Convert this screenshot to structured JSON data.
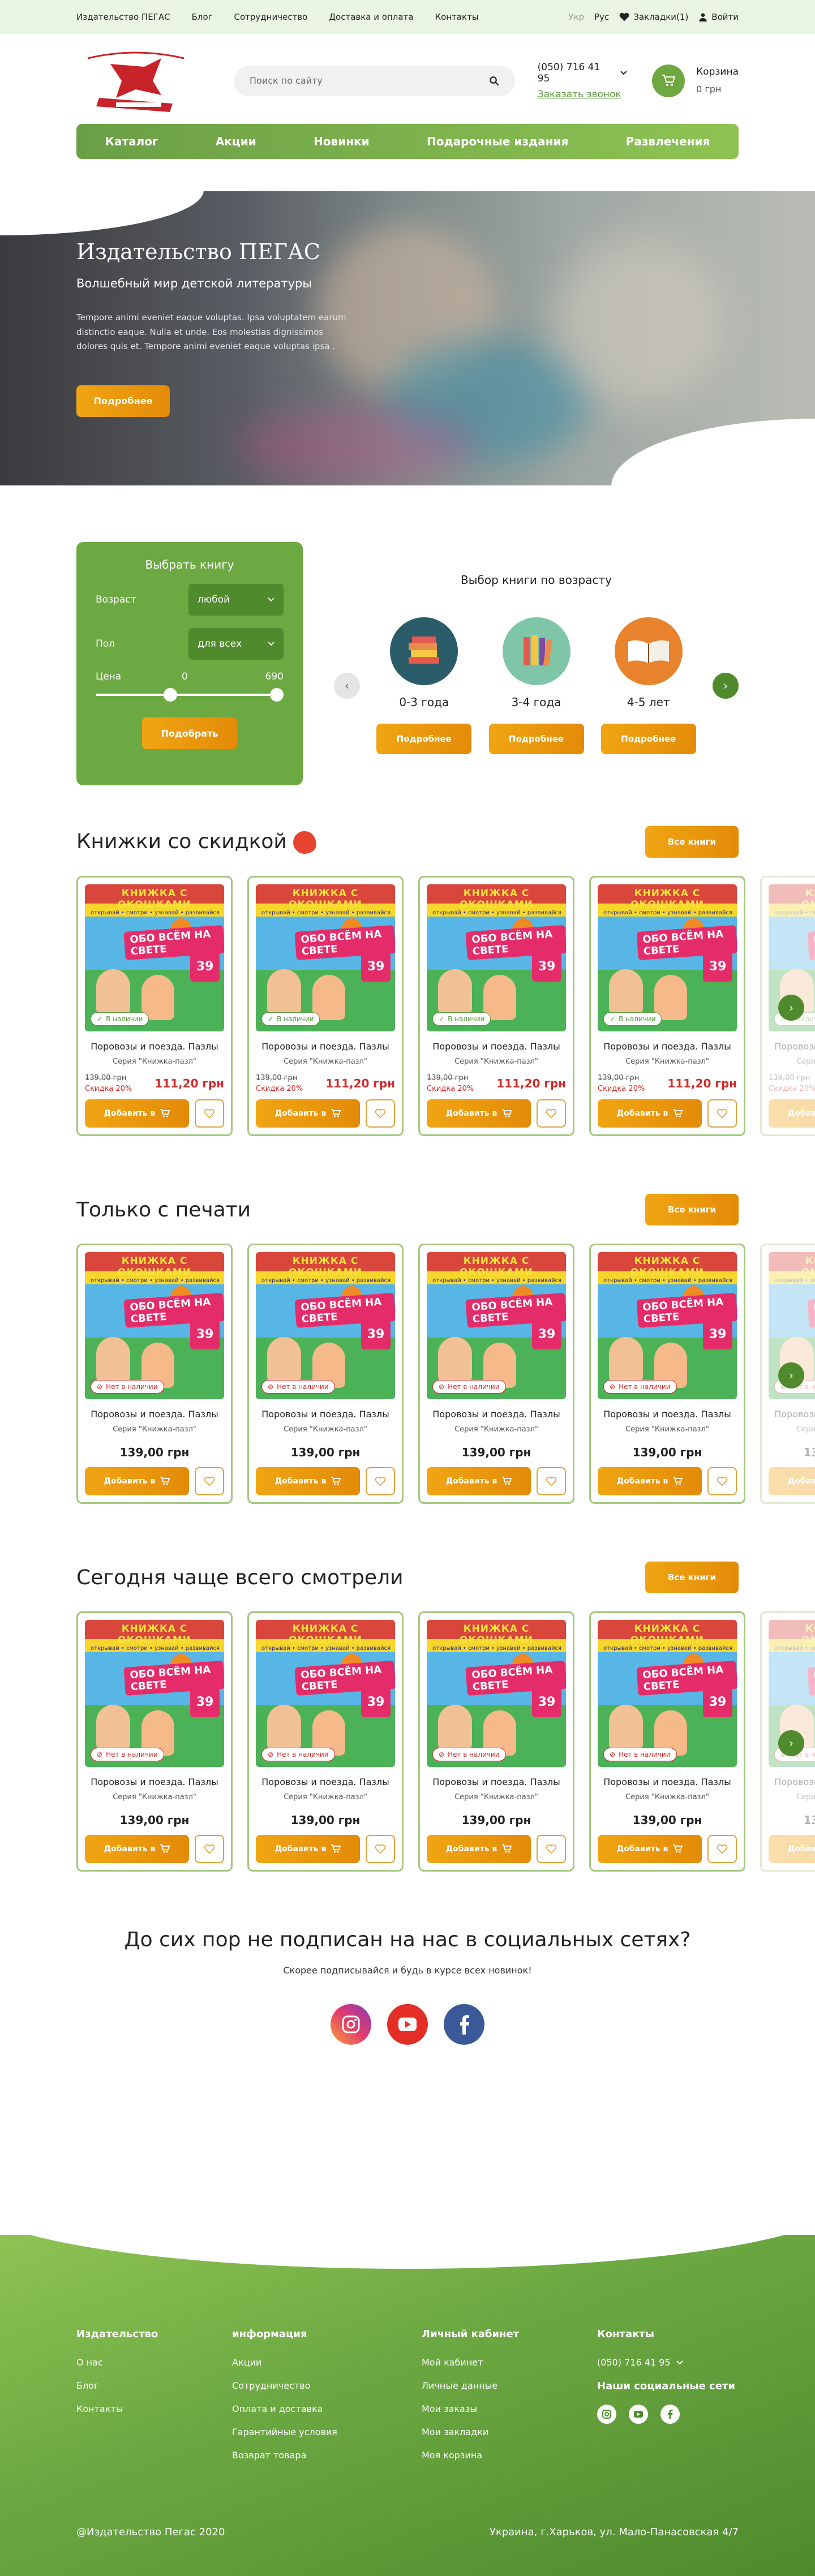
{
  "topbar": {
    "nav": [
      "Издательство ПЕГАС",
      "Блог",
      "Сотрудничество",
      "Доставка и оплата",
      "Контакты"
    ],
    "lang_ukr": "Укр",
    "lang_rus": "Рус",
    "bookmarks": "Закладки(1)",
    "login": "Войти"
  },
  "header": {
    "logo_text": "ВИДАВНИЦТВО ДИТЯЧОЇ ЛІТЕРАТУРИ",
    "search_placeholder": "Поиск по сайту",
    "phone": "(050) 716 41 95",
    "call_link": "Заказать звонок",
    "cart_label": "Корзина",
    "cart_sum": "0 грн"
  },
  "menu": [
    "Каталог",
    "Акции",
    "Новинки",
    "Подарочные издания",
    "Развлечения"
  ],
  "hero": {
    "title": "Издательство ПЕГАС",
    "subtitle": "Волшебный мир детской литературы",
    "text": "Tempore animi eveniet eaque voluptas. Ipsa voluptatem earum distinctio eaque. Nulla et unde. Eos molestias dignissimos dolores quis et. Tempore animi eveniet eaque voluptas ipsa .",
    "button": "Подробнее"
  },
  "filter": {
    "title": "Выбрать книгу",
    "age_label": "Возраст",
    "age_value": "любой",
    "sex_label": "Пол",
    "sex_value": "для всех",
    "price_label": "Цена",
    "price_min": "0",
    "price_max": "690",
    "button": "Подобрать"
  },
  "age_select": {
    "title": "Выбор книги по возрасту",
    "items": [
      {
        "label": "0-3 года",
        "button": "Подробнее",
        "color": "#2a5b69"
      },
      {
        "label": "3-4 года",
        "button": "Подробнее",
        "color": "#7fc6a8"
      },
      {
        "label": "4-5 лет",
        "button": "Подробнее",
        "color": "#e8822c"
      }
    ]
  },
  "sections": [
    {
      "title": "Книжки со скидкой",
      "button": "Все книги"
    },
    {
      "title": "Только с печати",
      "button": "Все книги"
    },
    {
      "title": "Сегодня чаще всего смотрели",
      "button": "Все книги"
    }
  ],
  "product": {
    "cover_title": "КНИЖКА С ОКОШКАМИ",
    "cover_sub": "открывай • смотри • узнавай • развивайся",
    "cover_name": "ОБО ВСЁМ НА СВЕТЕ",
    "cover_num": "39",
    "name": "Поровозы и поезда. Пазлы",
    "series": "Серия \"Книжка-пазл\"",
    "in_stock": "В наличии",
    "out_stock": "Нет в наличии",
    "old_price": "139,00 грн",
    "discount": "Скидка 20%",
    "new_price": "111,20 грн",
    "price": "139,00 грн",
    "add_button": "Добавить в"
  },
  "social": {
    "title": "До сих пор не подписан на нас в социальных сетях?",
    "text": "Скорее подписывайся и будь в курсе всех новинок!"
  },
  "footer": {
    "col1": {
      "title": "Издательство",
      "items": [
        "О нас",
        "Блог",
        "Контакты"
      ]
    },
    "col2": {
      "title": "информация",
      "items": [
        "Акции",
        "Сотрудничество",
        "Оплата и доставка",
        "Гарантийные условия",
        "Возврат товара"
      ]
    },
    "col3": {
      "title": "Личный кабинет",
      "items": [
        "Мой кабинет",
        "Личные данные",
        "Мои заказы",
        "Мои закладки",
        "Моя корзина"
      ]
    },
    "col4": {
      "title": "Контакты",
      "phone": "(050) 716 41 95",
      "social_title": "Наши социальные сети"
    },
    "copyright": "@Издательство Пегас 2020",
    "address": "Украина,  г.Харьков, ул. Мало-Панасовская 4/7"
  },
  "colors": {
    "accent": "#6da942",
    "button": "#f0a513",
    "sale": "#d12b2b"
  }
}
